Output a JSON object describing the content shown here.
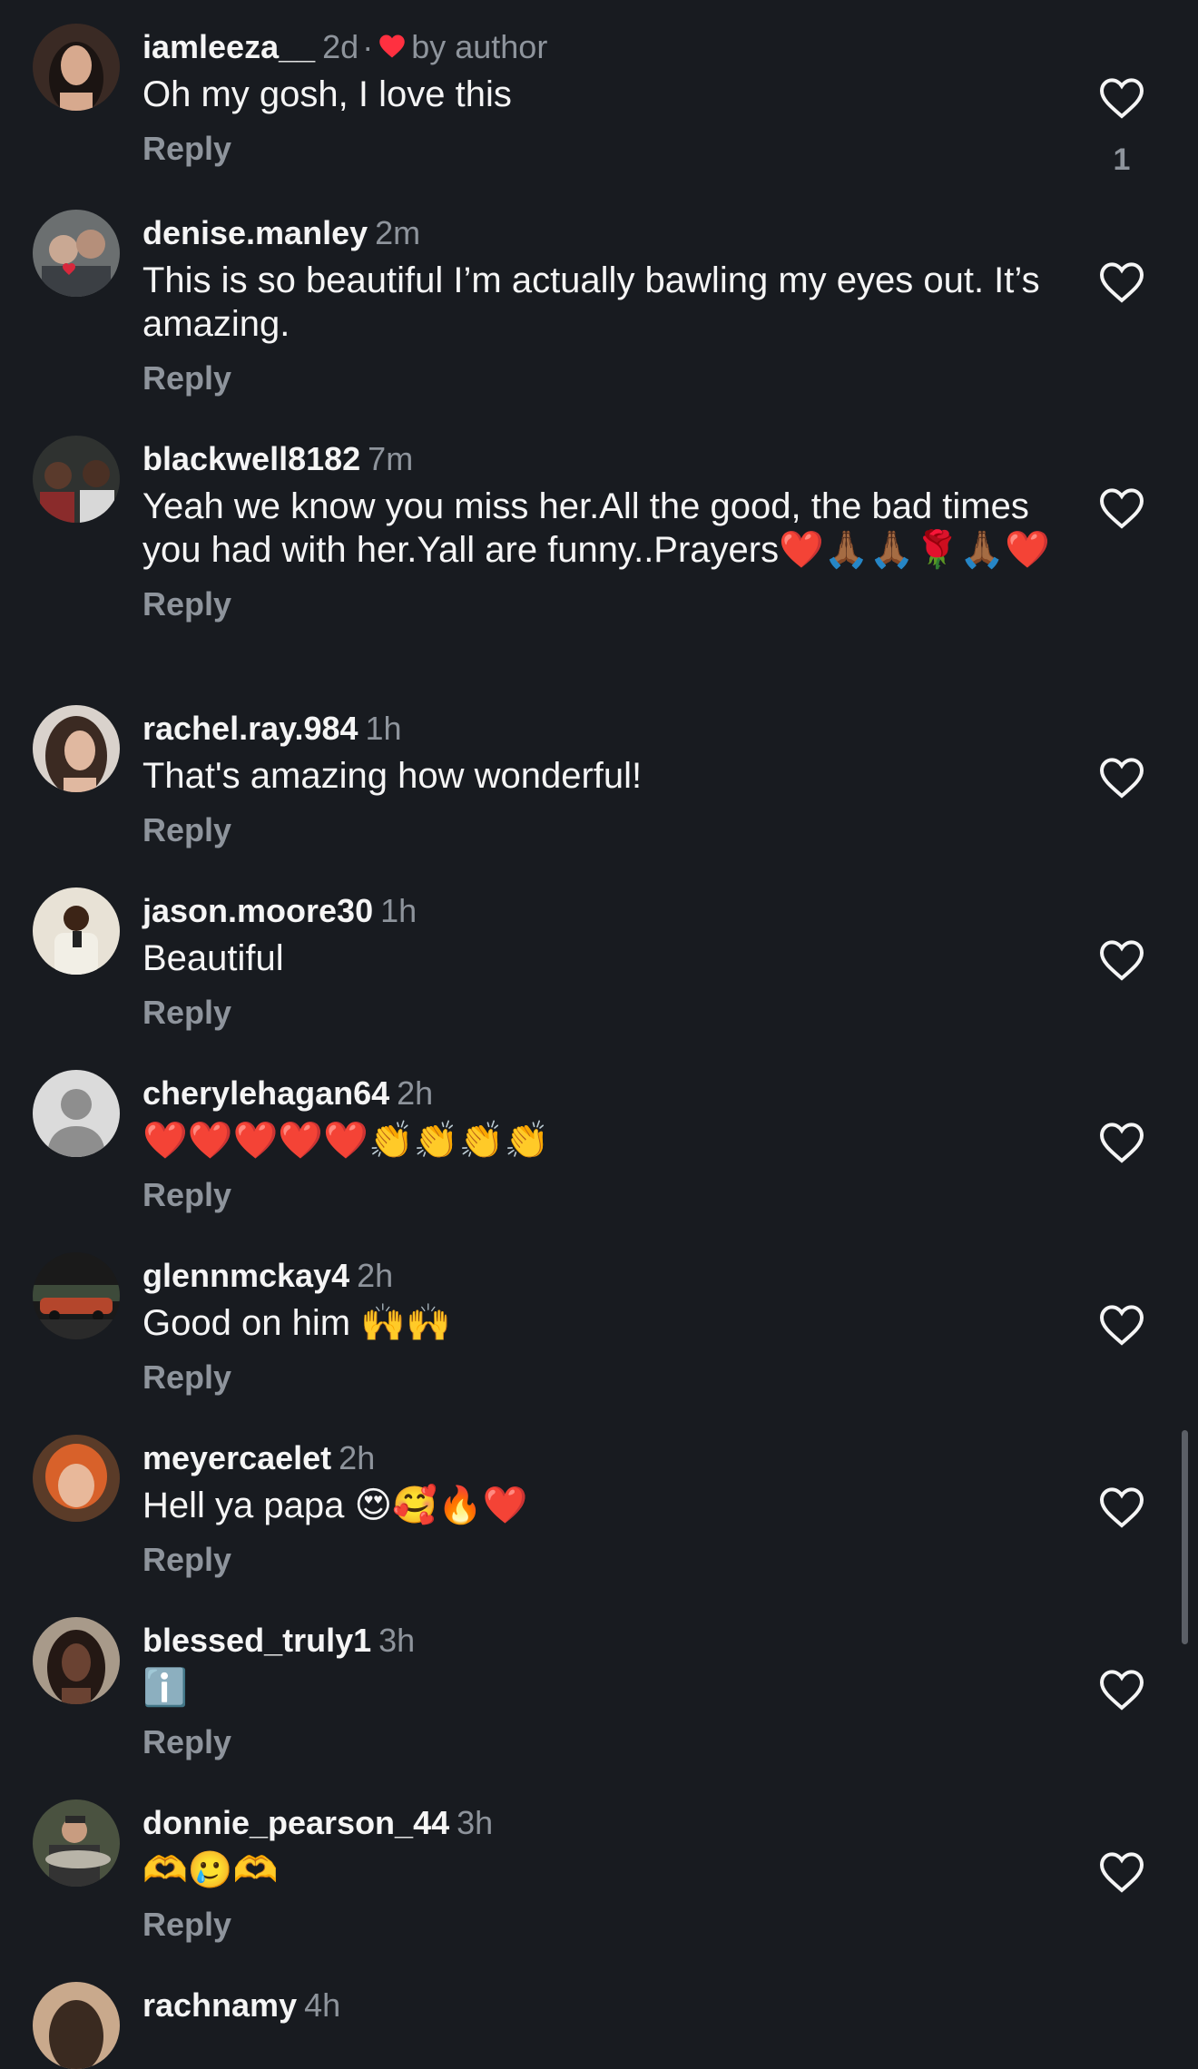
{
  "comments": [
    {
      "username": "iamleeza__",
      "time": "2d",
      "by_author": "by author",
      "text": "Oh my gosh, I love this",
      "reply": "Reply",
      "like_count": "1"
    },
    {
      "username": "denise.manley",
      "time": "2m",
      "text": "This is so beautiful I’m actually bawling my eyes out. It’s amazing.",
      "reply": "Reply"
    },
    {
      "username": "blackwell8182",
      "time": "7m",
      "text": "Yeah we know you miss her.All the good, the bad times you had with her.Yall are funny..Prayers❤️🙏🏾🙏🏾🌹🙏🏾❤️",
      "reply": "Reply"
    },
    {
      "username": "rachel.ray.984",
      "time": "1h",
      "text": "That's amazing how wonderful!",
      "reply": "Reply"
    },
    {
      "username": "jason.moore30",
      "time": "1h",
      "text": "Beautiful",
      "reply": "Reply"
    },
    {
      "username": "cherylehagan64",
      "time": "2h",
      "text": "❤️❤️❤️❤️❤️👏👏👏👏",
      "reply": "Reply"
    },
    {
      "username": "glennmckay4",
      "time": "2h",
      "text": "Good on him 🙌🙌",
      "reply": "Reply"
    },
    {
      "username": "meyercaelet",
      "time": "2h",
      "text": "Hell ya papa 😍🥰🔥❤️",
      "reply": "Reply"
    },
    {
      "username": "blessed_truly1",
      "time": "3h",
      "text": "ℹ️",
      "reply": "Reply"
    },
    {
      "username": "donnie_pearson_44",
      "time": "3h",
      "text": "🫶🥲🫶",
      "reply": "Reply"
    },
    {
      "username": "rachnamy",
      "time": "4h"
    }
  ],
  "colors": {
    "background": "#181b20",
    "primary_text": "#f5f5f5",
    "secondary_text": "#8e949c",
    "author_heart": "#ff3040"
  },
  "icons": {
    "like": "heart-outline-icon",
    "author_like": "heart-filled-icon",
    "default_avatar": "person-silhouette-icon"
  }
}
